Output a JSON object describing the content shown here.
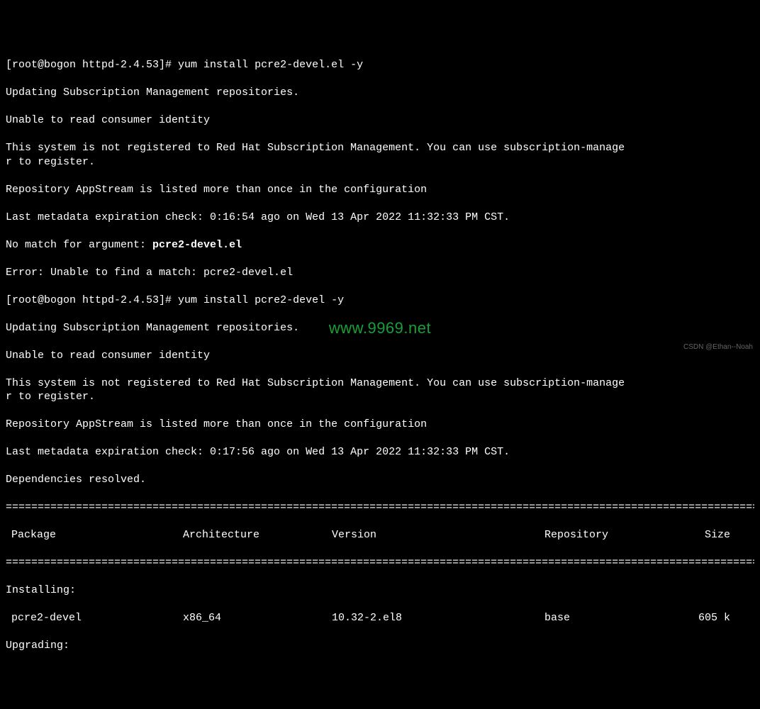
{
  "prompt1_prefix": "[root@bogon httpd-2.4.53]# ",
  "prompt1_cmd": "yum install pcre2-devel.el -y",
  "line_updating": "Updating Subscription Management repositories.",
  "line_unable": "Unable to read consumer identity",
  "line_notreg": "This system is not registered to Red Hat Subscription Management. You can use subscription-manage\nr to register.",
  "line_repo": "Repository AppStream is listed more than once in the configuration",
  "line_meta1": "Last metadata expiration check: 0:16:54 ago on Wed 13 Apr 2022 11:32:33 PM CST.",
  "line_nomatch_prefix": "No match for argument: ",
  "line_nomatch_pkg": "pcre2-devel.el",
  "line_error": "Error: Unable to find a match: pcre2-devel.el",
  "prompt2_prefix": "[root@bogon httpd-2.4.53]# ",
  "prompt2_cmd": "yum install pcre2-devel -y",
  "line_meta2": "Last metadata expiration check: 0:17:56 ago on Wed 13 Apr 2022 11:32:33 PM CST.",
  "line_dep": "Dependencies resolved.",
  "divider": "================================================================================================================================",
  "headers": {
    "package": "Package",
    "arch": "Architecture",
    "version": "Version",
    "repo": "Repository",
    "size": "Size"
  },
  "installing_label": "Installing:",
  "row": {
    "package": "pcre2-devel",
    "arch": "x86_64",
    "version": "10.32-2.el8",
    "repo": "base",
    "size": "605 k"
  },
  "upgrading_label": "Upgrading:",
  "watermark": "www.9969.net",
  "credit": "CSDN @Ethan--Noah"
}
